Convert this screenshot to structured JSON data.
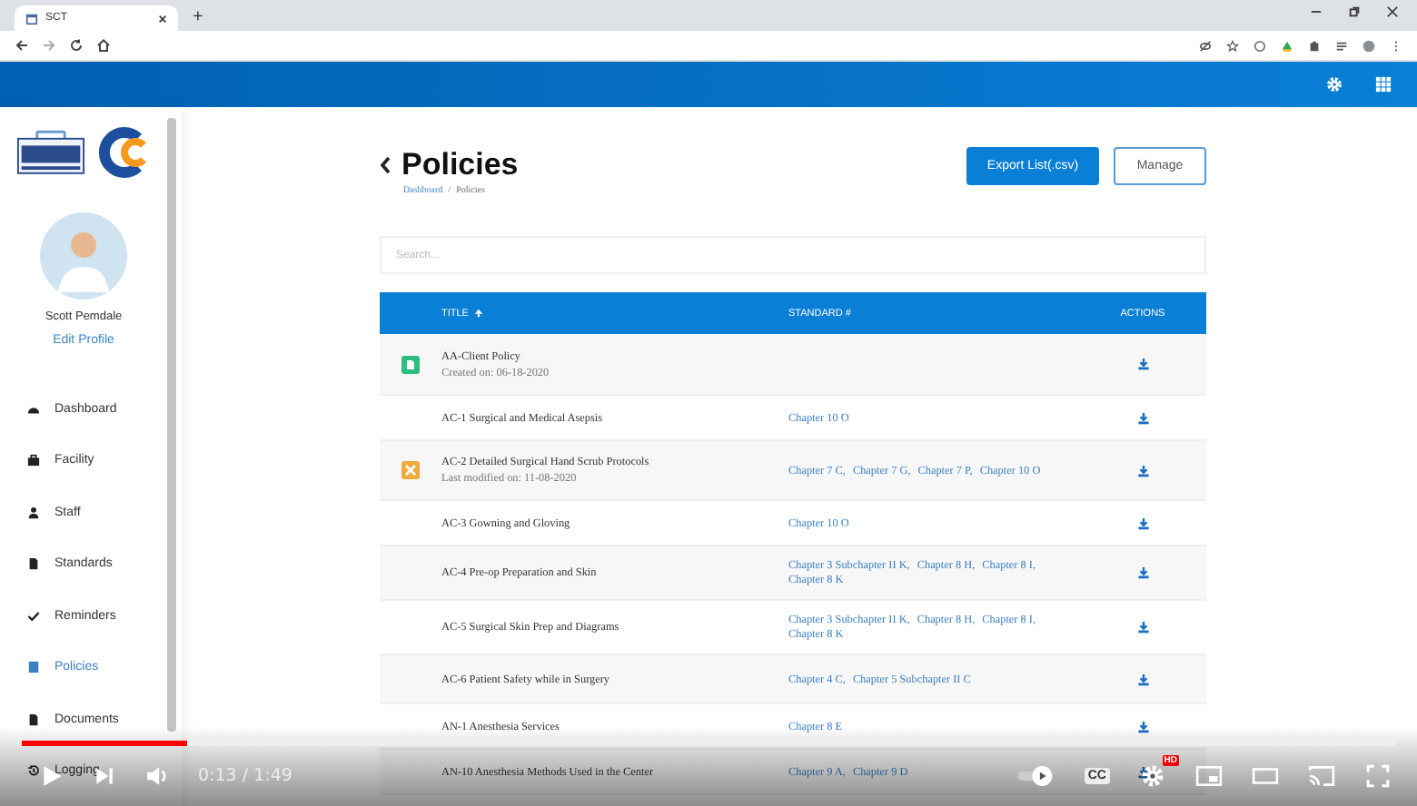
{
  "browser": {
    "tab_title": "SCT",
    "new_tab": "+"
  },
  "sidebar": {
    "user_name": "Scott Pemdale",
    "edit_profile": "Edit Profile",
    "items": [
      {
        "label": "Dashboard",
        "kind": "dashboard",
        "selected": false
      },
      {
        "label": "Facility",
        "kind": "briefcase",
        "selected": false
      },
      {
        "label": "Staff",
        "kind": "person",
        "selected": false
      },
      {
        "label": "Standards",
        "kind": "file",
        "selected": false
      },
      {
        "label": "Reminders",
        "kind": "check",
        "selected": false
      },
      {
        "label": "Policies",
        "kind": "book",
        "selected": true
      },
      {
        "label": "Documents",
        "kind": "file",
        "selected": false
      },
      {
        "label": "Logging",
        "kind": "history",
        "selected": false
      }
    ]
  },
  "page": {
    "title": "Policies",
    "breadcrumb": [
      "Dashboard",
      "/",
      "Policies"
    ],
    "export_button": "Export List(.csv)",
    "manage_button": "Manage",
    "search": {
      "placeholder": "Search..."
    }
  },
  "table": {
    "columns": [
      "TITLE",
      "STANDARD #",
      "ACTIONS"
    ],
    "rows": [
      {
        "kind": "document",
        "title": "AA-Client Policy",
        "subtitle": "Created on: 06-18-2020",
        "standards": []
      },
      {
        "kind": "plain",
        "title": "AC-1 Surgical and Medical Asepsis",
        "standards": [
          "Chapter 10 O"
        ]
      },
      {
        "kind": "tools",
        "title": "AC-2 Detailed Surgical Hand Scrub Protocols",
        "subtitle": "Last modified on: 11-08-2020",
        "standards": [
          "Chapter 7 C,",
          "Chapter 7 G,",
          "Chapter 7 P,",
          "Chapter 10 O"
        ]
      },
      {
        "kind": "plain",
        "title": "AC-3 Gowning and Gloving",
        "standards": [
          "Chapter 10 O"
        ]
      },
      {
        "kind": "plain",
        "title": "AC-4 Pre-op Preparation and Skin",
        "standards": [
          "Chapter 3 Subchapter II K,",
          "Chapter 8 H,",
          "Chapter 8 I,",
          "Chapter 8 K"
        ]
      },
      {
        "kind": "plain",
        "title": "AC-5 Surgical Skin Prep and Diagrams",
        "standards": [
          "Chapter 3 Subchapter II K,",
          "Chapter 8 H,",
          "Chapter 8 I,",
          "Chapter 8 K"
        ]
      },
      {
        "kind": "plain",
        "title": "AC-6 Patient Safety while in Surgery",
        "standards": [
          "Chapter 4 C,",
          "Chapter 5 Subchapter II C"
        ]
      },
      {
        "kind": "plain",
        "title": "AN-1 Anesthesia Services",
        "standards": [
          "Chapter 8 E"
        ]
      },
      {
        "kind": "plain",
        "title": "AN-10 Anesthesia Methods Used in the Center",
        "standards": [
          "Chapter 9 A,",
          "Chapter 9 D"
        ]
      }
    ]
  },
  "video": {
    "progress": {
      "level": 0.12
    },
    "time": "0:13 / 1:49",
    "cc": "CC",
    "hd": "HD"
  }
}
